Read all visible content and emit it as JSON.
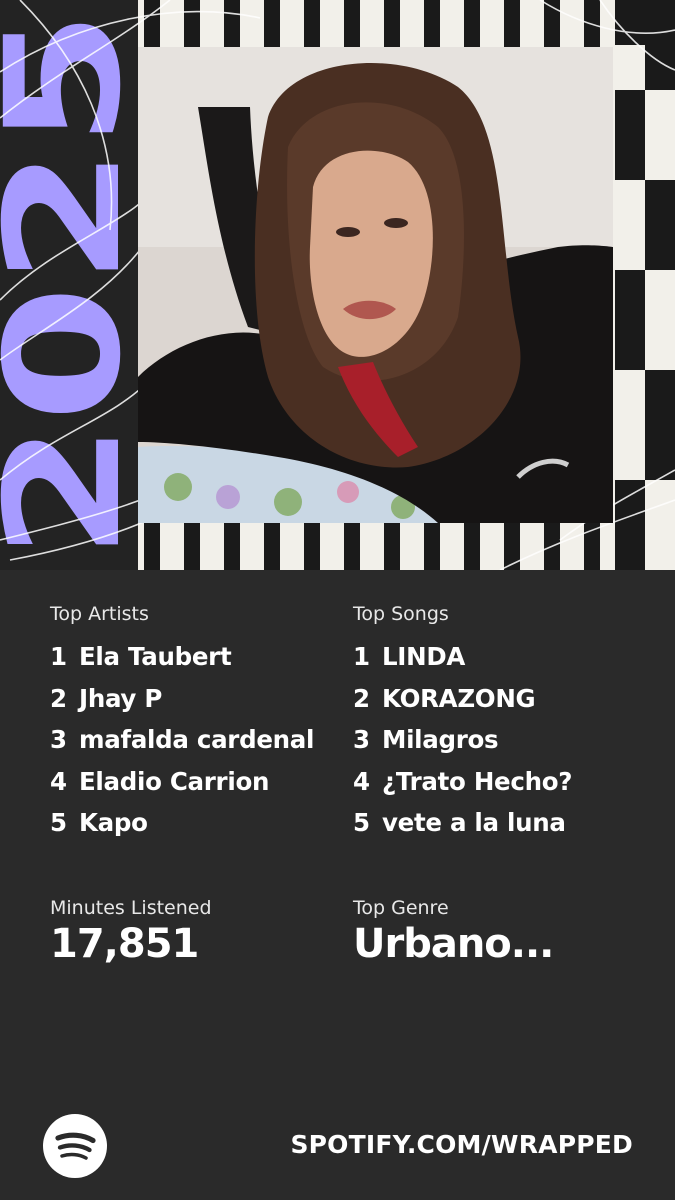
{
  "year": "2025",
  "colors": {
    "background": "#2a2a2a",
    "accent": "#a79bff",
    "stripe_light": "#f2f0ea",
    "stripe_dark": "#1a1a1a"
  },
  "top_artists": {
    "label": "Top Artists",
    "items": [
      {
        "rank": "1",
        "name": "Ela Taubert"
      },
      {
        "rank": "2",
        "name": "Jhay P"
      },
      {
        "rank": "3",
        "name": "mafalda cardenal"
      },
      {
        "rank": "4",
        "name": "Eladio Carrion"
      },
      {
        "rank": "5",
        "name": "Kapo"
      }
    ]
  },
  "top_songs": {
    "label": "Top Songs",
    "items": [
      {
        "rank": "1",
        "name": "LINDA"
      },
      {
        "rank": "2",
        "name": "KORAZONG"
      },
      {
        "rank": "3",
        "name": "Milagros"
      },
      {
        "rank": "4",
        "name": "¿Trato Hecho?"
      },
      {
        "rank": "5",
        "name": "vete a la luna"
      }
    ]
  },
  "minutes": {
    "label": "Minutes Listened",
    "value": "17,851"
  },
  "genre": {
    "label": "Top Genre",
    "value": "Urbano..."
  },
  "footer": {
    "logo_icon": "spotify-logo-icon",
    "url": "SPOTIFY.COM/WRAPPED"
  }
}
